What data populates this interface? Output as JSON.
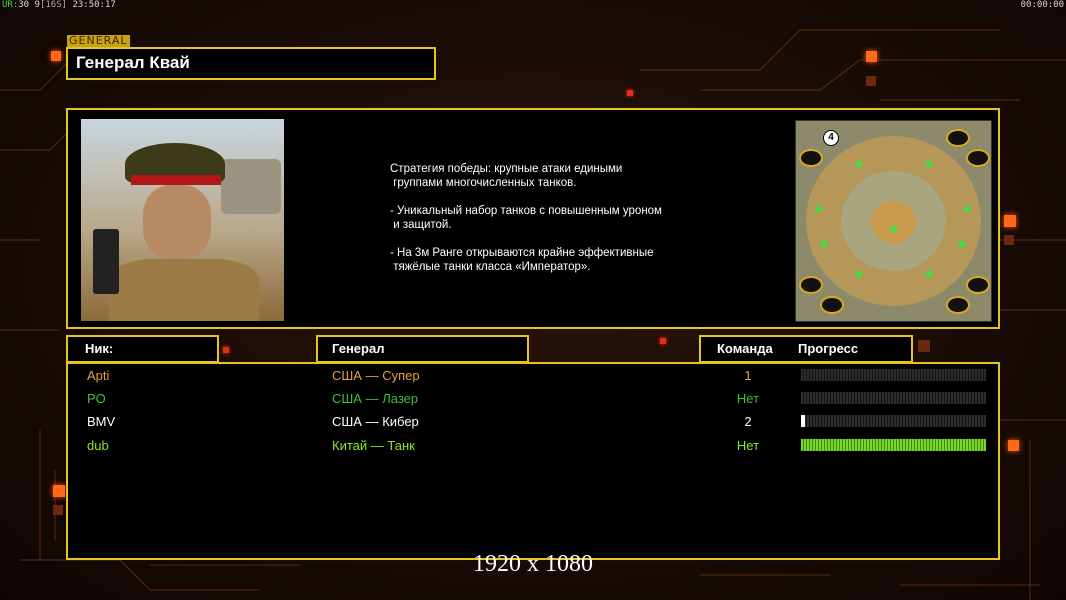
{
  "topbar": {
    "ur": "UR:",
    "fps": "30 9",
    "fps_bracket": "[16S]",
    "clock": "23:50:17",
    "timer": "00:00:00"
  },
  "header": {
    "tag": "GENERAL",
    "title": "Генерал Квай"
  },
  "info": {
    "strategy": [
      "Стратегия победы: крупные атаки едиными\n группами многочисленных танков.",
      "- Уникальный набор танков с повышенным уроном\n и защитой.",
      "- На 3м Ранге открываются крайне эффективные\n тяжёлые танки класса «Император»."
    ],
    "map_badge": "4"
  },
  "columns": {
    "nick": "Ник:",
    "general": "Генерал",
    "team": "Команда",
    "progress": "Прогресс"
  },
  "players": [
    {
      "nick": "Apti",
      "general": "США — Супер",
      "team": "1",
      "progress": 0.0,
      "color": "#e8a040"
    },
    {
      "nick": "PO",
      "general": "США — Лазер",
      "team": "Нет",
      "progress": 0.0,
      "color": "#3fbf3a"
    },
    {
      "nick": "BMV",
      "general": "США — Кибер",
      "team": "2",
      "progress": 0.01,
      "color": "#ffffff"
    },
    {
      "nick": "dub",
      "general": "Китай — Танк",
      "team": "Нет",
      "progress": 1.0,
      "color": "#8fe81e"
    }
  ],
  "colors": {
    "accent_gold": "#e6c321",
    "accent_orange": "#ff6a1a",
    "bar_green": "#7ad82a"
  },
  "resolution": "1920 x 1080"
}
